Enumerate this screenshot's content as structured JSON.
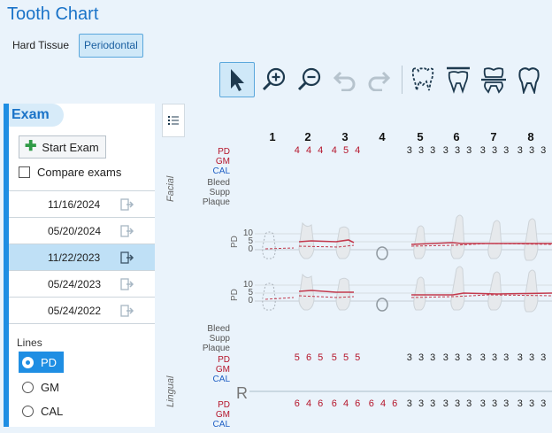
{
  "header": {
    "title": "Tooth Chart"
  },
  "subtabs": [
    {
      "label": "Hard Tissue"
    },
    {
      "label": "Periodontal"
    }
  ],
  "toolbar": {
    "items": [
      "pointer-icon",
      "zoom-in-icon",
      "zoom-out-icon",
      "undo-icon",
      "redo-icon",
      "upper-teeth-icon",
      "lower-teeth-icon",
      "bite-view-icon",
      "single-tooth-icon"
    ]
  },
  "exam_panel": {
    "tab_label": "Exam",
    "start_label": "Start Exam",
    "compare_label": "Compare exams",
    "exams": [
      {
        "date": "11/16/2024"
      },
      {
        "date": "05/20/2024"
      },
      {
        "date": "11/22/2023"
      },
      {
        "date": "05/24/2023"
      },
      {
        "date": "05/24/2022"
      }
    ],
    "selected_index": 2,
    "lines_label": "Lines",
    "lines": [
      {
        "label": "PD"
      },
      {
        "label": "GM"
      },
      {
        "label": "CAL"
      }
    ],
    "selected_line": "PD"
  },
  "chart": {
    "teeth": [
      "1",
      "2",
      "3",
      "4",
      "5",
      "6",
      "7",
      "8"
    ],
    "facial_label": "Facial",
    "lingual_label": "Lingual",
    "quadrant_label": "R",
    "row_labels": {
      "pd": "PD",
      "gm": "GM",
      "cal": "CAL",
      "bleed": "Bleed",
      "supp": "Supp",
      "plaque": "Plaque"
    },
    "graph_axis": {
      "label": "PD",
      "ticks": [
        "10",
        "5",
        "0"
      ]
    },
    "facial_pd": [
      "",
      "4 4 4",
      "4 5 4",
      "",
      "3 3 3",
      "3 3 3",
      "3 3 3",
      "3 3 3"
    ],
    "lingual_pd": [
      "",
      "5 6 5",
      "5 5 5",
      "",
      "3 3 3",
      "3 3 3",
      "3 3 3",
      "3 3 3"
    ],
    "lower_pd": [
      "",
      "6 4 6",
      "6 4 6",
      "6 4 6",
      "3 3 3",
      "3 3 3",
      "3 3 3",
      "3 3 3"
    ]
  },
  "colors": {
    "accent": "#1f8ee3",
    "pd": "#b5152b",
    "cal": "#1f5fc4"
  }
}
